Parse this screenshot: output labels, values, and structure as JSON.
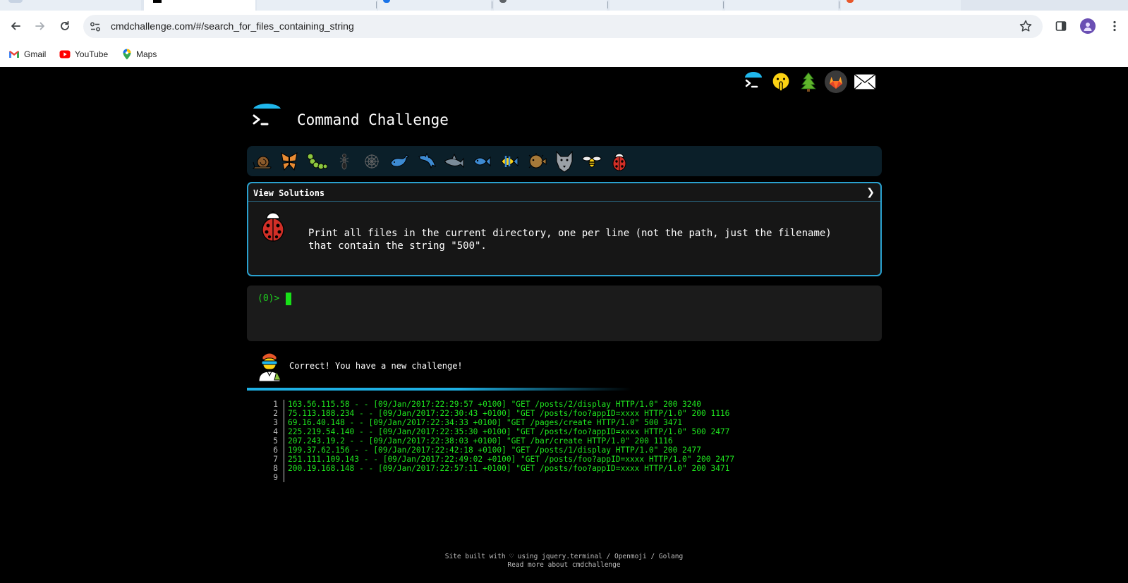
{
  "browser": {
    "url": "cmdchallenge.com/#/search_for_files_containing_string",
    "bookmarks": [
      {
        "label": "Gmail",
        "icon": "gmail-icon"
      },
      {
        "label": "YouTube",
        "icon": "youtube-icon"
      },
      {
        "label": "Maps",
        "icon": "maps-icon"
      }
    ]
  },
  "site": {
    "title": "Command Challenge",
    "top_icons": [
      "terminal-logo-icon",
      "shushing-face-icon",
      "evergreen-tree-icon",
      "gitlab-icon",
      "envelope-icon"
    ],
    "animals": [
      "snail-icon",
      "butterfly-icon",
      "caterpillar-icon",
      "ant-icon",
      "spider-web-icon",
      "whale-icon",
      "dolphin-icon",
      "shark-icon",
      "fish-icon",
      "tropical-fish-icon",
      "blowfish-icon",
      "wolf-icon",
      "bee-icon",
      "ladybug-icon"
    ]
  },
  "challenge": {
    "header": "View Solutions",
    "chevron": "❯",
    "text_line1": "Print all files in the current directory, one per line (not the path, just the filename)",
    "text_line2": "that contain the string \"500\"."
  },
  "terminal": {
    "prompt": "(0)>"
  },
  "result": {
    "message": "Correct! You have a new challenge!",
    "progress": 0.6
  },
  "output": [
    {
      "n": "1",
      "text": "163.56.115.58 - - [09/Jan/2017:22:29:57 +0100] \"GET /posts/2/display HTTP/1.0\" 200 3240"
    },
    {
      "n": "2",
      "text": "75.113.188.234 - - [09/Jan/2017:22:30:43 +0100] \"GET /posts/foo?appID=xxxx HTTP/1.0\" 200 1116"
    },
    {
      "n": "3",
      "text": "69.16.40.148 - - [09/Jan/2017:22:34:33 +0100] \"GET /pages/create HTTP/1.0\" 500 3471"
    },
    {
      "n": "4",
      "text": "225.219.54.140 - - [09/Jan/2017:22:35:30 +0100] \"GET /posts/foo?appID=xxxx HTTP/1.0\" 500 2477"
    },
    {
      "n": "5",
      "text": "207.243.19.2 - - [09/Jan/2017:22:38:03 +0100] \"GET /bar/create HTTP/1.0\" 200 1116"
    },
    {
      "n": "6",
      "text": "199.37.62.156 - - [09/Jan/2017:22:42:18 +0100] \"GET /posts/1/display HTTP/1.0\" 200 2477"
    },
    {
      "n": "7",
      "text": "251.111.109.143 - - [09/Jan/2017:22:49:02 +0100] \"GET /posts/foo?appID=xxxx HTTP/1.0\" 200 2477"
    },
    {
      "n": "8",
      "text": "200.19.168.148 - - [09/Jan/2017:22:57:11 +0100] \"GET /posts/foo?appID=xxxx HTTP/1.0\" 200 3471"
    },
    {
      "n": "9",
      "text": ""
    }
  ],
  "footer": {
    "line1": "Site built with ♡ using jquery.terminal / Openmoji / Golang",
    "line2": "Read more about cmdchallenge"
  }
}
